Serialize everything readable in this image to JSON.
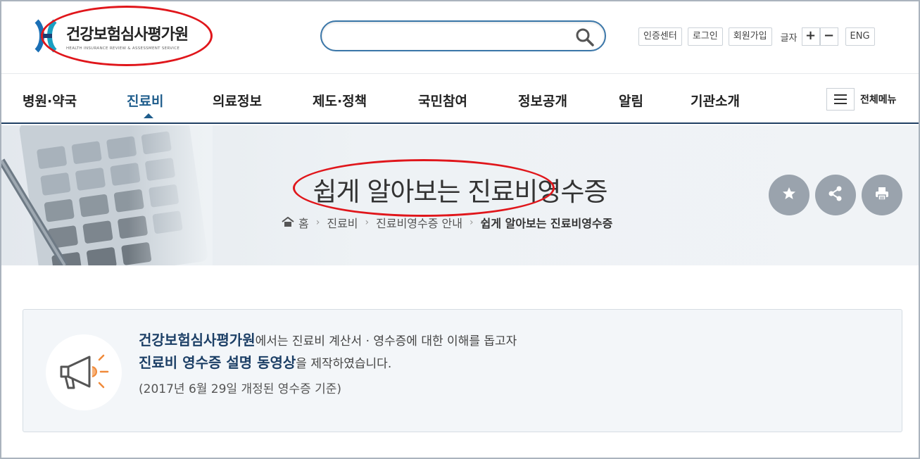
{
  "header": {
    "logo_title": "건강보험심사평가원",
    "logo_subtitle": "HEALTH INSURANCE REVIEW & ASSESSMENT SERVICE",
    "search_placeholder": "",
    "util": {
      "cert_center": "인증센터",
      "login": "로그인",
      "signup": "회원가입",
      "font_size_label": "글자",
      "font_plus": "+",
      "font_minus": "−",
      "eng": "ENG"
    }
  },
  "nav": {
    "items": [
      {
        "label": "병원·약국"
      },
      {
        "label": "진료비",
        "active": true
      },
      {
        "label": "의료정보"
      },
      {
        "label": "제도·정책"
      },
      {
        "label": "국민참여"
      },
      {
        "label": "정보공개"
      },
      {
        "label": "알림"
      },
      {
        "label": "기관소개"
      }
    ],
    "all_menu_label": "전체메뉴"
  },
  "banner": {
    "title": "쉽게 알아보는 진료비영수증",
    "breadcrumb": [
      "홈",
      "진료비",
      "진료비영수증 안내",
      "쉽게 알아보는 진료비영수증"
    ],
    "actions": [
      "star-icon",
      "share-icon",
      "print-icon"
    ]
  },
  "notice": {
    "org_name": "건강보험심사평가원",
    "line1_rest": "에서는 진료비 계산서 · 영수증에 대한 이해를 돕고자",
    "video_title": "진료비 영수증 설명 동영상",
    "line2_rest": "을 제작하였습니다.",
    "line3": "(2017년 6월 29일 개정된 영수증 기준)"
  },
  "colors": {
    "accent": "#1f5d8c",
    "nav_border": "#1f3f63",
    "annotation_red": "#e0161b",
    "circle_button": "#9aa3ad"
  }
}
